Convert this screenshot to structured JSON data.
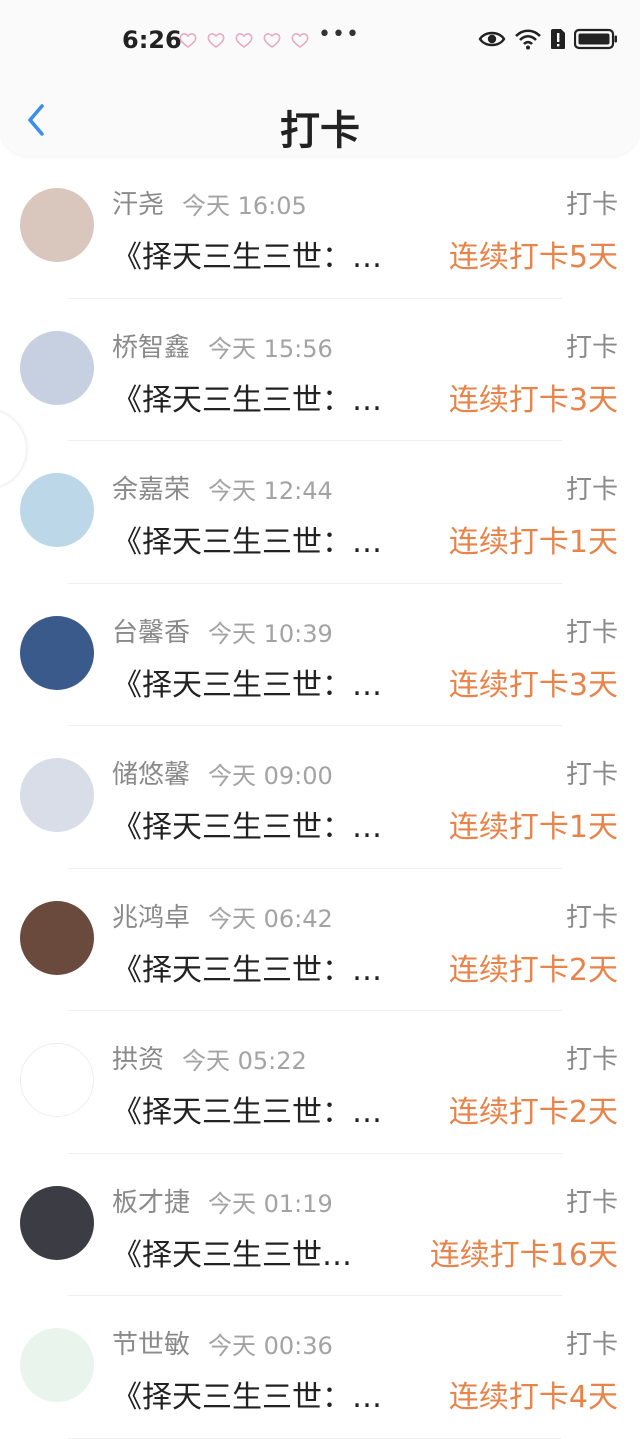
{
  "status": {
    "time": "6:26",
    "dots": "•••"
  },
  "header": {
    "title": "打卡",
    "back_icon": "chevron-left-icon"
  },
  "colors": {
    "accent": "#e8834a",
    "back": "#3b8ef0"
  },
  "items": [
    {
      "name": "汗尧",
      "time": "今天 16:05",
      "action": "打卡",
      "content": "《择天三生三世：…",
      "streak": "连续打卡5天",
      "avatar": "#d9c7bd"
    },
    {
      "name": "桥智鑫",
      "time": "今天 15:56",
      "action": "打卡",
      "content": "《择天三生三世：…",
      "streak": "连续打卡3天",
      "avatar": "#c7d0e0"
    },
    {
      "name": "余嘉荣",
      "time": "今天 12:44",
      "action": "打卡",
      "content": "《择天三生三世：…",
      "streak": "连续打卡1天",
      "avatar": "#bcd8e8"
    },
    {
      "name": "台馨香",
      "time": "今天 10:39",
      "action": "打卡",
      "content": "《择天三生三世：…",
      "streak": "连续打卡3天",
      "avatar": "#3a5a8c"
    },
    {
      "name": "储悠馨",
      "time": "今天 09:00",
      "action": "打卡",
      "content": "《择天三生三世：…",
      "streak": "连续打卡1天",
      "avatar": "#d8dde8"
    },
    {
      "name": "兆鸿卓",
      "time": "今天 06:42",
      "action": "打卡",
      "content": "《择天三生三世：…",
      "streak": "连续打卡2天",
      "avatar": "#6b4a3e"
    },
    {
      "name": "拱资",
      "time": "今天 05:22",
      "action": "打卡",
      "content": "《择天三生三世：…",
      "streak": "连续打卡2天",
      "avatar": "#ffffff"
    },
    {
      "name": "板才捷",
      "time": "今天 01:19",
      "action": "打卡",
      "content": "《择天三生三世…",
      "streak": "连续打卡16天",
      "avatar": "#3c3c44"
    },
    {
      "name": "节世敏",
      "time": "今天 00:36",
      "action": "打卡",
      "content": "《择天三生三世：…",
      "streak": "连续打卡4天",
      "avatar": "#e8f4ec"
    }
  ]
}
